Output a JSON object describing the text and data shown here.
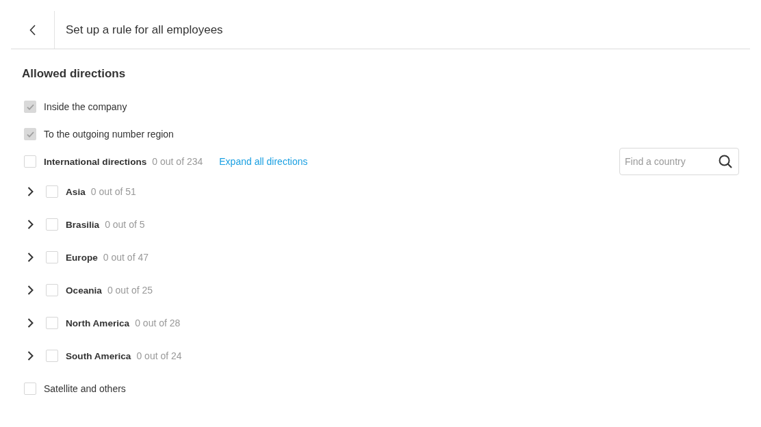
{
  "header": {
    "title": "Set up a rule for all employees"
  },
  "section": {
    "title": "Allowed directions"
  },
  "search": {
    "placeholder": "Find a country"
  },
  "directions": [
    {
      "kind": "option",
      "label": "Inside the company",
      "checked": true,
      "disabled": true
    },
    {
      "kind": "option",
      "label": "To the outgoing number region",
      "checked": true,
      "disabled": true
    },
    {
      "kind": "group",
      "label": "International directions",
      "count": "0 out of 234",
      "checked": false,
      "disabled": false,
      "link": "Expand all directions",
      "children": [
        {
          "kind": "region",
          "label": "Asia",
          "count": "0 out of 51",
          "checked": false,
          "disabled": false,
          "expanded": false
        },
        {
          "kind": "region",
          "label": "Brasilia",
          "count": "0 out of 5",
          "checked": false,
          "disabled": false,
          "expanded": false
        },
        {
          "kind": "region",
          "label": "Europe",
          "count": "0 out of 47",
          "checked": false,
          "disabled": false,
          "expanded": false
        },
        {
          "kind": "region",
          "label": "Oceania",
          "count": "0 out of 25",
          "checked": false,
          "disabled": false,
          "expanded": false
        },
        {
          "kind": "region",
          "label": "North America",
          "count": "0 out of 28",
          "checked": false,
          "disabled": false,
          "expanded": false
        },
        {
          "kind": "region",
          "label": "South America",
          "count": "0 out of 24",
          "checked": false,
          "disabled": false,
          "expanded": false
        }
      ]
    },
    {
      "kind": "option",
      "label": "Satellite and others",
      "checked": false,
      "disabled": false
    }
  ]
}
